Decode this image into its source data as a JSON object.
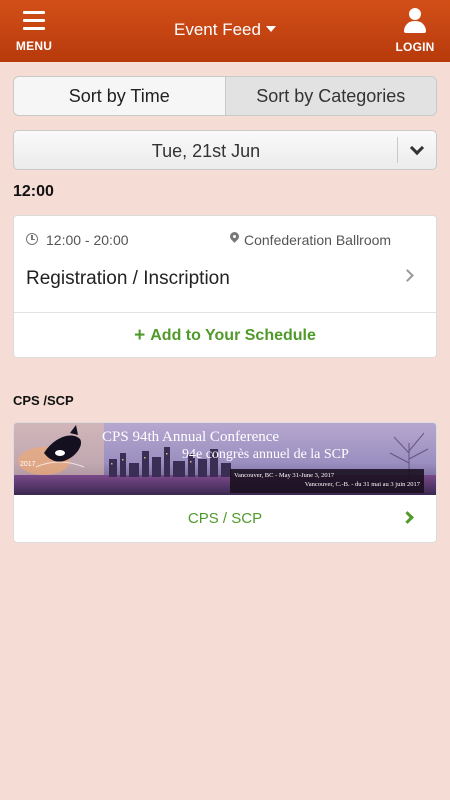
{
  "header": {
    "menu_label": "MENU",
    "title": "Event Feed",
    "login_label": "LOGIN"
  },
  "sort": {
    "by_time": "Sort by Time",
    "by_categories": "Sort by Categories",
    "selected": "by_time"
  },
  "date_selector": {
    "value": "Tue, 21st Jun"
  },
  "time_group": "12:00",
  "event": {
    "time": "12:00 - 20:00",
    "location": "Confederation Ballroom",
    "title": "Registration / Inscription",
    "add_label": "Add to Your Schedule"
  },
  "sponsor_section": {
    "heading": "CPS /SCP",
    "banner_title": "CPS 94th Annual Conference",
    "banner_subtitle": "94e congrès annuel de la SCP",
    "banner_line1": "Vancouver, BC - May 31-June 3, 2017",
    "banner_line2": "Vancouver, C.-B. - du 31 mai au 3 juin 2017",
    "banner_year": "2017",
    "link_label": "CPS / SCP"
  },
  "colors": {
    "header": "#c4440f",
    "background": "#f5dcd4",
    "accent_green": "#4f9a2a"
  }
}
